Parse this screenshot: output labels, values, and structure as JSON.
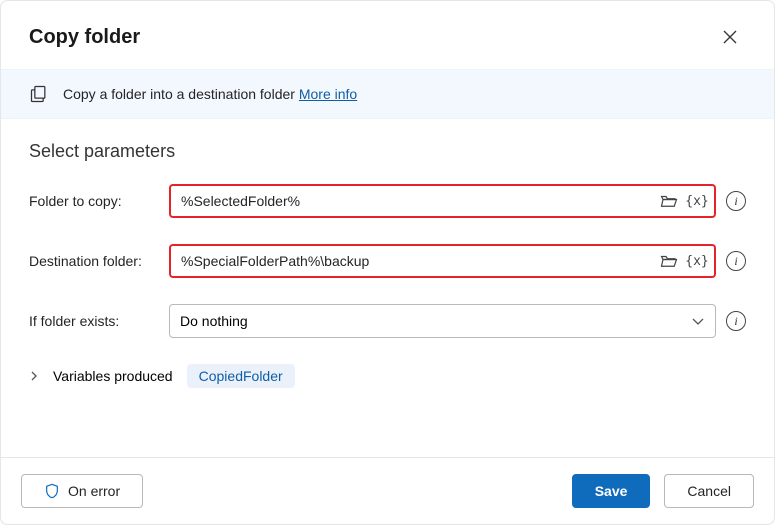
{
  "dialog": {
    "title": "Copy folder",
    "banner_text": "Copy a folder into a destination folder",
    "more_info": "More info"
  },
  "section": {
    "title": "Select parameters"
  },
  "fields": {
    "folder_to_copy": {
      "label": "Folder to copy:",
      "value": "%SelectedFolder%"
    },
    "destination_folder": {
      "label": "Destination folder:",
      "value": "%SpecialFolderPath%\\backup"
    },
    "if_folder_exists": {
      "label": "If folder exists:",
      "value": "Do nothing"
    }
  },
  "variables": {
    "label": "Variables produced",
    "chip": "CopiedFolder"
  },
  "buttons": {
    "on_error": "On error",
    "save": "Save",
    "cancel": "Cancel"
  }
}
